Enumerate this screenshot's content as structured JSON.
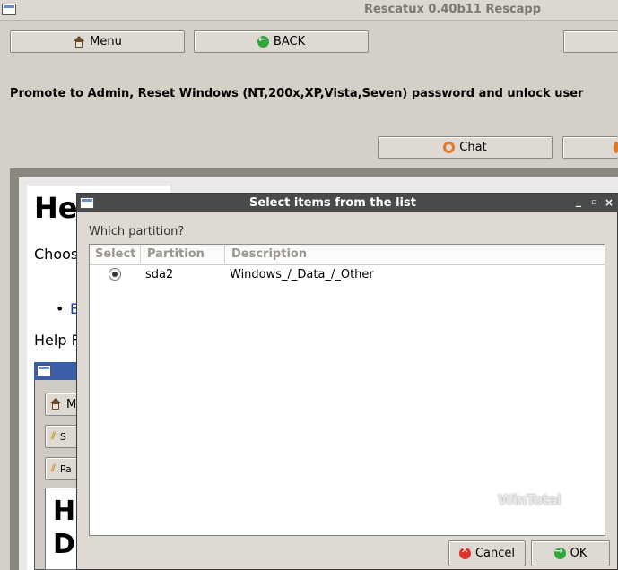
{
  "window": {
    "title": "Rescatux 0.40b11 Rescapp"
  },
  "toolbar": {
    "menu_label": "Menu",
    "back_label": "BACK"
  },
  "main": {
    "promote_text": "Promote to Admin, Reset Windows (NT,200x,XP,Vista,Seven) password and unlock user",
    "chat_label": "Chat"
  },
  "help": {
    "heading": "He",
    "choose": "Choos",
    "link": "E",
    "help_line": "Help F",
    "nested_big_1": "H",
    "nested_big_2": "D",
    "nested_btn_1": "M",
    "nested_btn_2": "S",
    "nested_btn_3": "Pa"
  },
  "dialog": {
    "title": "Select items from the list",
    "question": "Which partition?",
    "columns": [
      "Select",
      "Partition",
      "Description"
    ],
    "rows": [
      {
        "selected": true,
        "partition": "sda2",
        "description": "Windows_/_Data_/_Other"
      }
    ],
    "cancel_label": "Cancel",
    "ok_label": "OK",
    "watermark": "WinTotal"
  },
  "icons": {
    "menu": "house-icon",
    "back": "back-arrow-icon",
    "chat": "lifebuoy-icon",
    "cancel": "cancel-icon",
    "ok": "ok-icon"
  }
}
